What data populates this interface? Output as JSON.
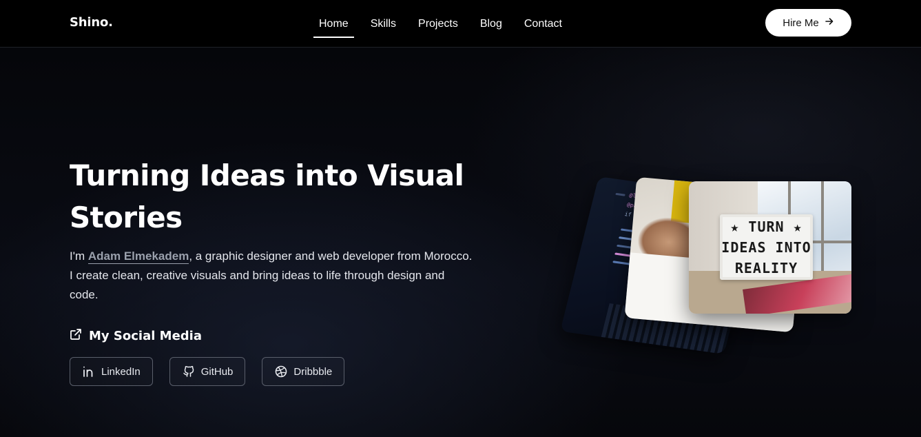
{
  "header": {
    "logo": "Shino.",
    "nav": [
      {
        "label": "Home",
        "active": true
      },
      {
        "label": "Skills"
      },
      {
        "label": "Projects"
      },
      {
        "label": "Blog"
      },
      {
        "label": "Contact"
      }
    ],
    "cta": {
      "label": "Hire Me",
      "icon": "arrow-right-icon"
    }
  },
  "hero": {
    "title": "Turning Ideas into Visual Stories",
    "intro_prefix": "I'm ",
    "name": "Adam Elmekadem",
    "intro_suffix": ", a graphic designer and web developer from Morocco. I create clean, creative visuals and bring ideas to life through design and code."
  },
  "social": {
    "heading": "My Social Media",
    "heading_icon": "external-link-icon",
    "links": [
      {
        "label": "LinkedIn",
        "icon": "linkedin-icon"
      },
      {
        "label": "GitHub",
        "icon": "github-icon"
      },
      {
        "label": "Dribbble",
        "icon": "dribbble-icon"
      }
    ]
  },
  "showcase": {
    "lightbox_lines": [
      "★ TURN ★",
      "IDEAS INTO",
      "REALITY"
    ],
    "code_snippet": [
      "@link hr",
      "@package",
      "if ( ! fun"
    ]
  },
  "colors": {
    "background": "#000000",
    "accent": "#ffffff",
    "muted_link": "#9aa0ac",
    "button_border": "#5a5f6b"
  }
}
